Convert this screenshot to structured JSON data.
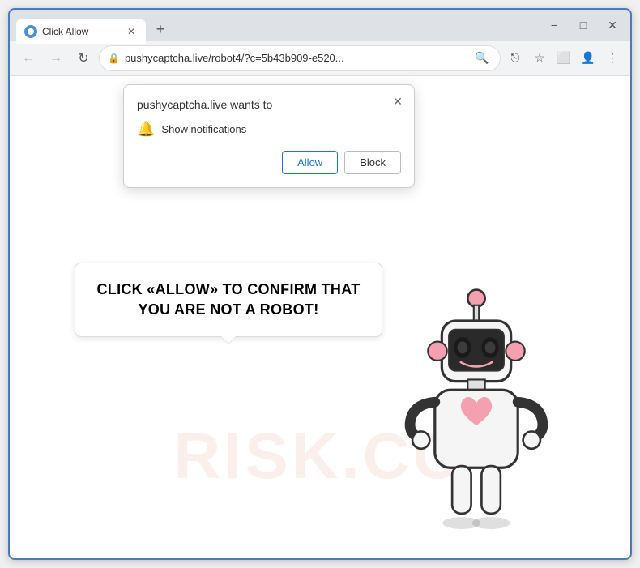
{
  "browser": {
    "tab_title": "Click Allow",
    "tab_favicon": "globe-icon",
    "new_tab_icon": "+",
    "window_controls": {
      "minimize": "−",
      "maximize": "□",
      "close": "✕"
    }
  },
  "navbar": {
    "back_icon": "←",
    "forward_icon": "→",
    "refresh_icon": "↻",
    "url": "pushycaptcha.live/robot4/?c=5b43b909-e520...",
    "search_icon": "🔍",
    "share_icon": "⎋",
    "bookmark_icon": "☆",
    "splitscreen_icon": "⬜",
    "profile_icon": "👤",
    "menu_icon": "⋮"
  },
  "notification_popup": {
    "title": "pushycaptcha.live wants to",
    "permission_icon": "🔔",
    "permission_label": "Show notifications",
    "close_icon": "✕",
    "allow_button": "Allow",
    "block_button": "Block"
  },
  "speech_bubble": {
    "text": "CLICK «ALLOW» TO CONFIRM THAT YOU ARE NOT A ROBOT!"
  },
  "watermark": {
    "text": "RISK.CO"
  },
  "colors": {
    "allow_btn_color": "#1a73e8",
    "browser_border": "#4a7bbf",
    "tab_bg": "#dee1e6"
  }
}
